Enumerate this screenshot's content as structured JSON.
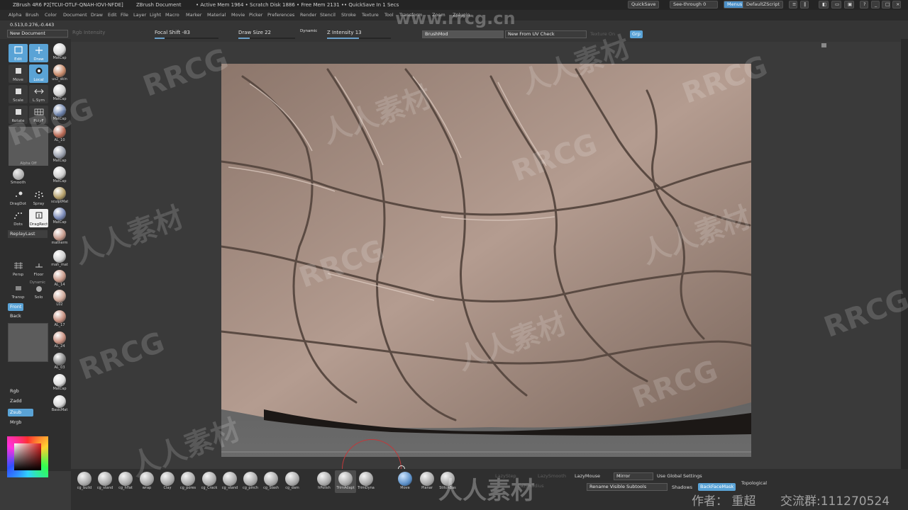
{
  "titlebar": {
    "app": "ZBrush 4R6 P2[TCUI-OTLF-QNAH-IOVI-NFDE]",
    "document": "ZBrush Document",
    "mem": "• Active Mem 1964 • Scratch Disk 1886 • Free Mem 2131 •• QuickSave In 1 Secs"
  },
  "topright": {
    "quicksave": "QuickSave",
    "seethrough": "See-through  0",
    "menus": "Menus",
    "script": "DefaultZScript"
  },
  "menus": [
    "Alpha",
    "Brush",
    "Color",
    "Document",
    "Draw",
    "Edit",
    "File",
    "Layer",
    "Light",
    "Macro",
    "Marker",
    "Material",
    "Movie",
    "Picker",
    "Preferences",
    "Render",
    "Stencil",
    "Stroke",
    "Texture",
    "Tool",
    "Transform",
    "Zoom",
    "Zplugin"
  ],
  "toolbar": {
    "new_document": "New Document",
    "coords": "0.513,0.276,-0.443",
    "rgb_intensity": "Rgb Intensity",
    "focal_shift": "Focal Shift -83",
    "draw_size": "Draw Size 22",
    "dynamic": "Dynamic",
    "z_intensity": "Z Intensity 13",
    "brushmod": "BrushMod",
    "new_from_uv": "New From UV Check",
    "texture_on": "Texture On",
    "grp": "Grp",
    "focal_shift_level": 0.15,
    "draw_size_level": 0.2,
    "z_intensity_level": 0.5
  },
  "left": {
    "tools": [
      "Edit",
      "Draw",
      "Move",
      "Scale",
      "Rotate",
      "L.Sym",
      "PolyF",
      "Local"
    ],
    "alpha_off": "Alpha  Off",
    "brushes": [
      "Smooth",
      "DragDot",
      "Spray",
      "Dots",
      "DragRect"
    ],
    "replaylast": "ReplayLast",
    "persp": "Persp",
    "floor": "Floor",
    "transp": "Transp",
    "solo": "Solo",
    "dynamic": "Dynamic",
    "front": "Front",
    "back": "Back",
    "rgb": "Rgb",
    "zadd": "Zadd",
    "zsub": "Zsub",
    "mrgb": "Mrgb"
  },
  "materials": [
    "MatCap",
    "us2_skin",
    "MatCap",
    "MatCap",
    "AL_10",
    "MatCap",
    "MatCap",
    "sculptMat",
    "MatCap",
    "matherm",
    "mah_mat",
    "AL_14",
    "L02",
    "AL_17",
    "AL_24",
    "AL_03",
    "MatCap",
    "BasicMat"
  ],
  "bottom": {
    "brushes": [
      "cg_build",
      "cg_stand",
      "cg_hflat",
      "wrap",
      "Clay",
      "cg_pores",
      "cg_Crack",
      "cg_stand",
      "cg_pinch",
      "cg_Slash",
      "cg_dam",
      "hPolish",
      "TrimAdapt",
      "TrimDyna",
      "Move",
      "Planar",
      "StitchBas"
    ],
    "lazystep": "LazyStep",
    "lazysmooth": "LazySmooth",
    "lazyradius": "LazyRadius",
    "lazymouse": "LazyMouse",
    "mirror": "Mirror",
    "use_global": "Use Global Settings",
    "rename": "Rename Visible Subtools",
    "shadows": "Shadows",
    "backfacemask": "BackFaceMask",
    "topological": "Topological"
  },
  "watermarks": {
    "site": "www.rrcg.cn",
    "brand": "RRCG",
    "cn": "人人素材",
    "author": "作者： 重超",
    "qq": "交流群:111270524"
  },
  "colors": {
    "accent": "#5aa3d6",
    "clay": "#c9b3a6"
  }
}
